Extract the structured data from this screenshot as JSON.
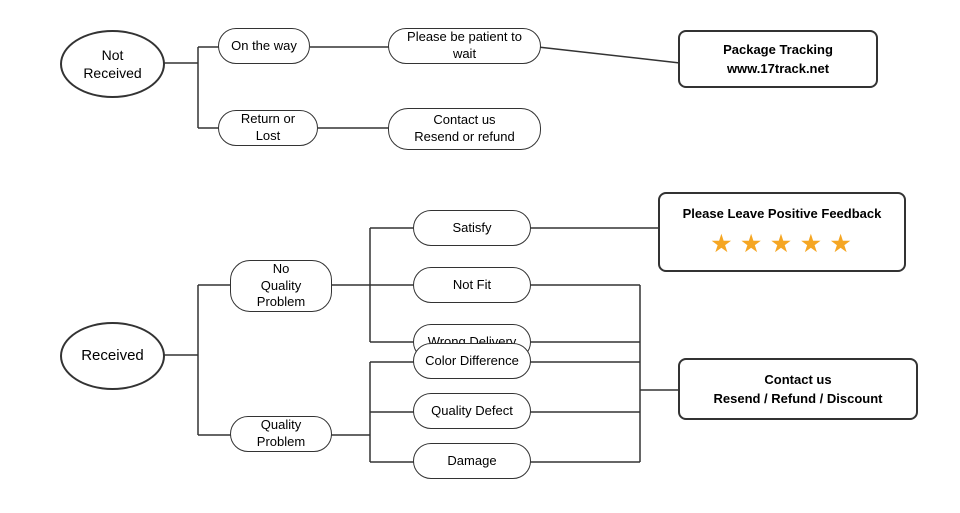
{
  "nodes": {
    "not_received": {
      "label": "Not\nReceived"
    },
    "on_the_way": {
      "label": "On the way"
    },
    "return_or_lost": {
      "label": "Return or Lost"
    },
    "patient_wait": {
      "label": "Please be patient to wait"
    },
    "contact_resend": {
      "label": "Contact us\nResend or refund"
    },
    "package_tracking": {
      "label": "Package Tracking\nwww.17track.net"
    },
    "received": {
      "label": "Received"
    },
    "no_quality_problem": {
      "label": "No\nQuality Problem"
    },
    "quality_problem": {
      "label": "Quality Problem"
    },
    "satisfy": {
      "label": "Satisfy"
    },
    "not_fit": {
      "label": "Not Fit"
    },
    "wrong_delivery": {
      "label": "Wrong Delivery"
    },
    "color_difference": {
      "label": "Color Difference"
    },
    "quality_defect": {
      "label": "Quality Defect"
    },
    "damage": {
      "label": "Damage"
    },
    "positive_feedback": {
      "label": "Please Leave Positive Feedback"
    },
    "stars": {
      "label": "★ ★ ★ ★ ★"
    },
    "contact_refund": {
      "label": "Contact us\nResend / Refund / Discount"
    }
  }
}
